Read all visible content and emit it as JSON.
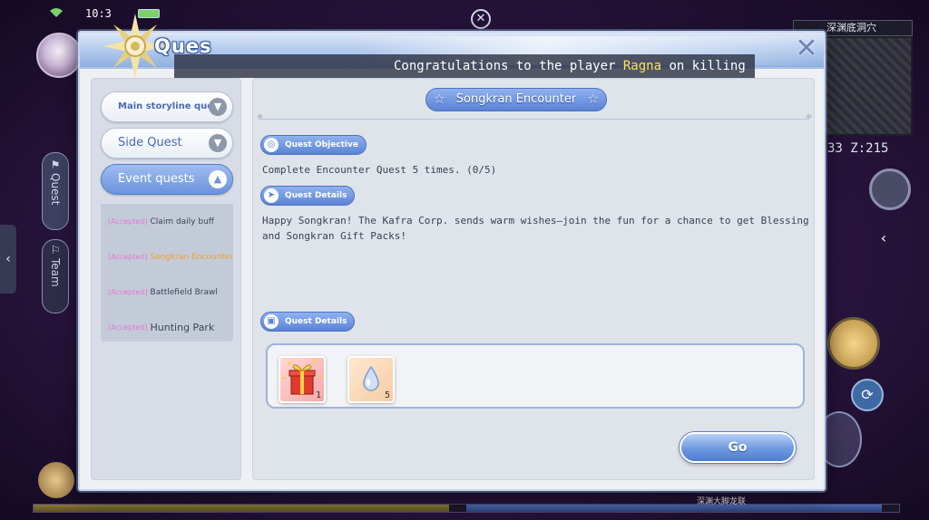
{
  "hud": {
    "clock": "10:3",
    "map_name": "深渊底洞穴",
    "coords": "33 Z:215",
    "left_tabs": [
      {
        "label": "Quest"
      },
      {
        "label": "Team"
      }
    ],
    "bottom_location": "深渊大脚龙联"
  },
  "panel": {
    "title": "Ques",
    "broadcast_prefix": "Congratulations to the player ",
    "broadcast_player": "Ragna",
    "broadcast_suffix": " on killing"
  },
  "sidebar": {
    "categories": [
      {
        "label": "Main storyline quest"
      },
      {
        "label": "Side Quest"
      },
      {
        "label": "Event quests"
      }
    ],
    "quests": [
      {
        "tag": "[Accepted]",
        "name": "Claim daily buff"
      },
      {
        "tag": "[Accepted]",
        "name": "Songkran Encounter"
      },
      {
        "tag": "[Accepted]",
        "name": "Battlefield Brawl"
      },
      {
        "tag": "[Accepted]",
        "name": "Hunting Park"
      }
    ]
  },
  "quest": {
    "title": "Songkran Encounter",
    "objective_label": "Quest Objective",
    "objective_text": "Complete Encounter Quest 5 times. (0/5)",
    "details_label": "Quest Details",
    "details_text_line1": "Happy Songkran! The Kafra Corp. sends warm wishes—join the fun for a chance to get Blessing",
    "details_text_line2": "and Songkran Gift Packs!",
    "rewards_label": "Quest Details",
    "rewards": [
      {
        "icon": "gift-box-icon",
        "qty": "1"
      },
      {
        "icon": "water-drop-icon",
        "qty": "5"
      }
    ],
    "go_label": "Go"
  },
  "colors": {
    "accent": "#5a83d6",
    "highlight_player": "#ffe25a",
    "selected_quest": "#f0a12b",
    "accepted_tag": "#e07ad6"
  }
}
